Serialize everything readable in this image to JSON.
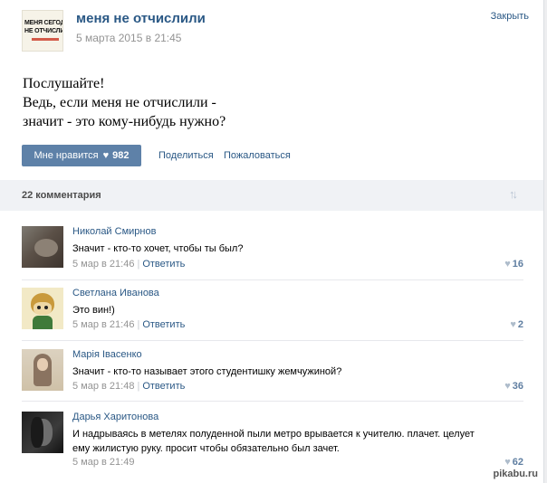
{
  "header": {
    "avatar_line1": "МЕНЯ СЕГОДНЯ",
    "avatar_line2": "НЕ ОТЧИСЛИЛИ",
    "title": "меня не отчислили",
    "date": "5 марта 2015 в 21:45",
    "close_label": "Закрыть"
  },
  "post": {
    "lines": [
      "Послушайте!",
      "Ведь, если меня не отчислили -",
      "значит - это кому-нибудь нужно?"
    ],
    "like_label": "Мне нравится",
    "like_count": "982",
    "share_label": "Поделиться",
    "report_label": "Пожаловаться"
  },
  "comments_header": {
    "title": "22 комментария"
  },
  "comments": [
    {
      "author": "Николай Смирнов",
      "text": "Значит - кто-то хочет, чтобы ты был?",
      "time": "5 мар в 21:46",
      "reply": "Ответить",
      "likes": "16"
    },
    {
      "author": "Светлана Иванова",
      "text": "Это вин!)",
      "time": "5 мар в 21:46",
      "reply": "Ответить",
      "likes": "2"
    },
    {
      "author": "Марія Івасенко",
      "text": "Значит - кто-то называет этого студентишку жемчужиной?",
      "time": "5 мар в 21:48",
      "reply": "Ответить",
      "likes": "36"
    },
    {
      "author": "Дарья Харитонова",
      "text": "И надрываясь в метелях полуденной пыли метро врывается к учителю. плачет. целует ему жилистую руку. просит чтобы обязательно был зачет.",
      "time": "5 мар в 21:49",
      "reply": "",
      "likes": "62"
    }
  ],
  "watermark": "pikabu.ru",
  "colors": {
    "link": "#2a5885",
    "like_button": "#5e81a8",
    "meta_gray": "#939393",
    "bar_bg": "#f0f2f5"
  },
  "icons": {
    "heart": "heart-icon",
    "sort": "sort-arrows-icon"
  }
}
